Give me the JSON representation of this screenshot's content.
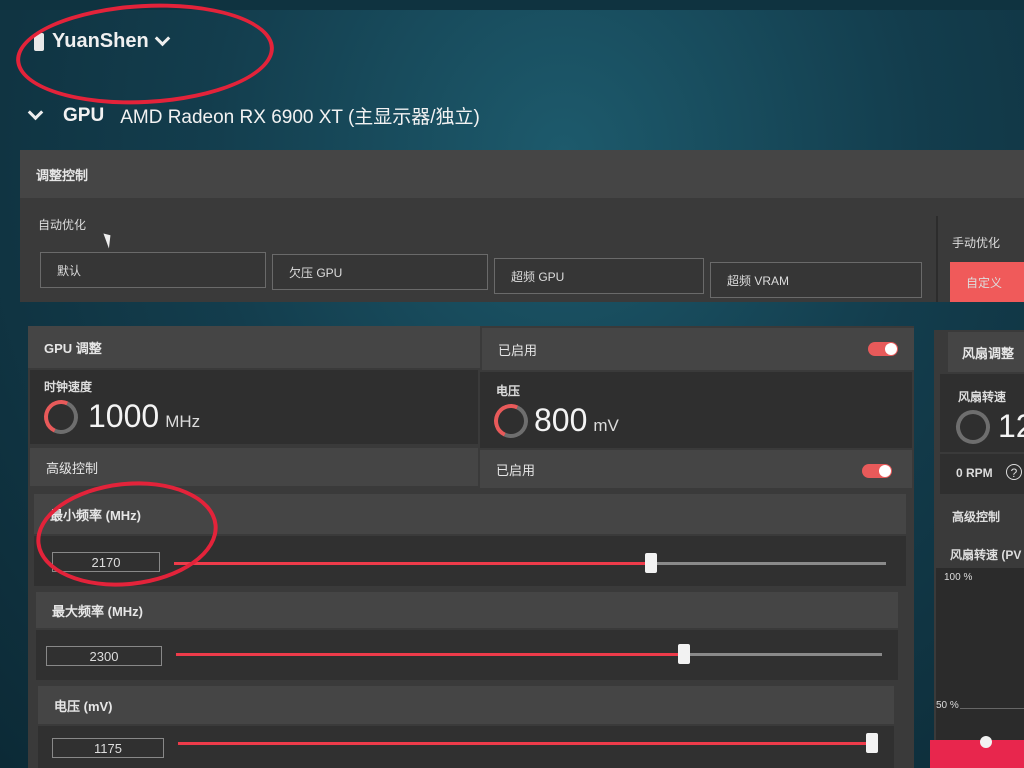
{
  "profile": {
    "name": "YuanShen"
  },
  "gpu": {
    "section_label": "GPU",
    "name": "AMD Radeon RX 6900 XT (主显示器/独立)"
  },
  "tuning": {
    "header": "调整控制",
    "auto_label": "自动优化",
    "buttons": [
      "默认",
      "欠压 GPU",
      "超频 GPU",
      "超频 VRAM"
    ],
    "manual_label": "手动优化",
    "custom_button": "自定义"
  },
  "gpu_tuning": {
    "header": "GPU 调整",
    "enabled_text": "已启用",
    "clock": {
      "label": "时钟速度",
      "value": "1000",
      "unit": "MHz"
    },
    "voltage": {
      "label": "电压",
      "value": "800",
      "unit": "mV"
    },
    "advanced_label": "高级控制",
    "advanced_enabled_text": "已启用",
    "sliders": [
      {
        "label": "最小频率 (MHz)",
        "value": "2170",
        "fraction": 0.67
      },
      {
        "label": "最大频率 (MHz)",
        "value": "2300",
        "fraction": 0.72
      },
      {
        "label": "电压 (mV)",
        "value": "1175",
        "fraction": 1.0
      }
    ]
  },
  "fan": {
    "header": "风扇调整",
    "speed_label": "风扇转速",
    "speed_value": "12",
    "rpm": "0 RPM",
    "help": "?",
    "advanced_label": "高级控制",
    "pwm_label": "风扇转速 (PV",
    "axis_top": "100 %",
    "axis_mid": "50 %"
  },
  "colors": {
    "accent": "#ee3b4a",
    "annotation": "#e3233a"
  }
}
